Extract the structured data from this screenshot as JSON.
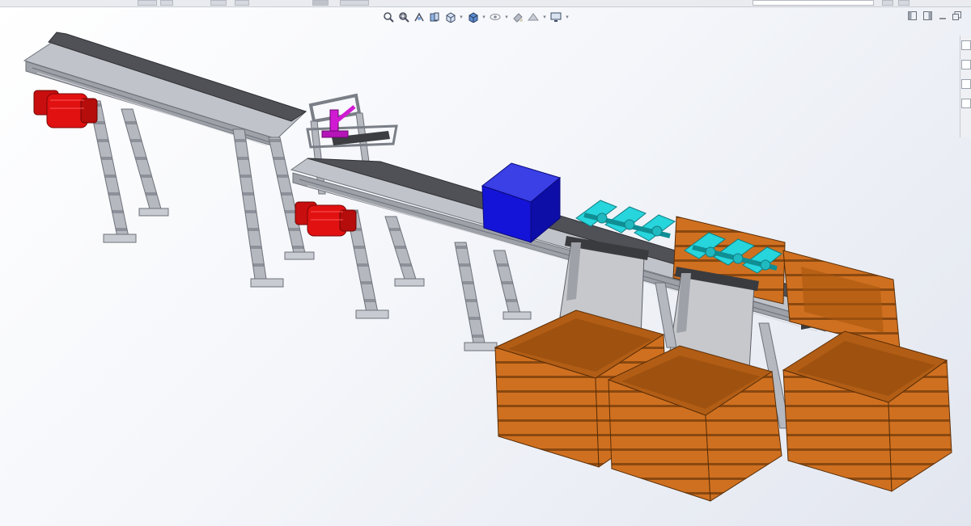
{
  "viewport": {
    "background": [
      "#ffffff",
      "#e2e6ef"
    ]
  },
  "heads_up_toolbar": {
    "buttons": [
      {
        "icon": "zoom-to-fit-icon"
      },
      {
        "icon": "zoom-to-area-icon"
      },
      {
        "icon": "previous-view-icon"
      },
      {
        "icon": "section-view-icon"
      },
      {
        "icon": "view-orientation-icon"
      },
      {
        "icon": "display-style-icon"
      },
      {
        "icon": "hide-show-items-icon"
      },
      {
        "icon": "edit-appearance-icon"
      },
      {
        "icon": "apply-scene-icon"
      },
      {
        "icon": "view-settings-icon"
      }
    ]
  },
  "window_controls": {
    "icons": [
      "tile-left-icon",
      "tile-right-icon",
      "minimize-icon",
      "restore-icon"
    ]
  },
  "model_colors": {
    "motor": "#e11111",
    "actuator": "#d01bd3",
    "sensor_box": "#1414d8",
    "rollers": "#27d5dc",
    "crates": "#cf7020",
    "belt": "#4f5156",
    "frame": "#b5b8bf",
    "chute": "#c6c8cc"
  }
}
